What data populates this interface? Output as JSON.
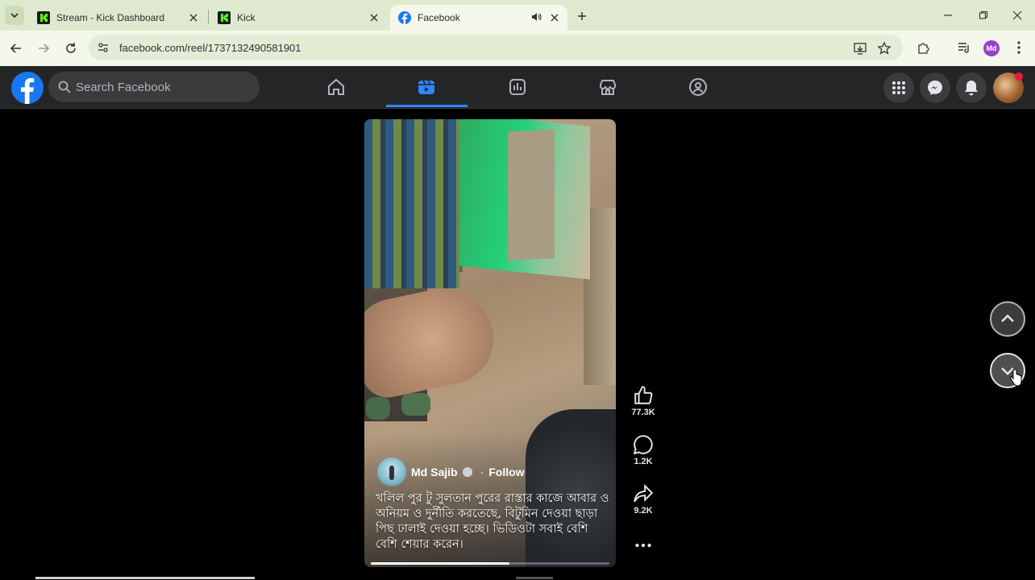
{
  "browser": {
    "tabs": [
      {
        "title": "Stream - Kick Dashboard",
        "active": false
      },
      {
        "title": "Kick",
        "active": false
      },
      {
        "title": "Facebook",
        "active": true
      }
    ],
    "url": "facebook.com/reel/1737132490581901",
    "profile_initials": "Md"
  },
  "facebook": {
    "search_placeholder": "Search Facebook",
    "brand_color": "#1877f2",
    "accent_color": "#2d88ff"
  },
  "reel": {
    "author": "Md Sajib",
    "follow_label": "Follow",
    "separator": "·",
    "caption": "খলিল পুর টু সুলতান পুরের রাস্তার কাজে আবার ও অনিয়ম ও দুর্নীতি করতেছে, বিটুমিন দেওয়া ছাড়া পিছ ঢালাই দেওয়া হচ্ছে। ভিডিওটা সবাই বেশি বেশি শেয়ার করেন।",
    "progress": 0.58
  },
  "actions": {
    "likes": "77.3K",
    "comments": "1.2K",
    "shares": "9.2K"
  }
}
